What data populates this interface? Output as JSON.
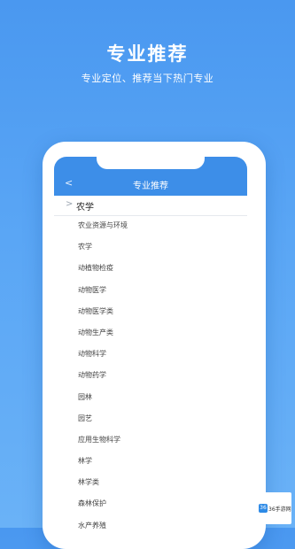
{
  "hero": {
    "title": "专业推荐",
    "subtitle": "专业定位、推荐当下热门专业"
  },
  "nav": {
    "back_icon": "chevron-left-icon",
    "back_glyph": "<",
    "title": "专业推荐"
  },
  "group": {
    "toggle_icon": "chevron-right-icon",
    "toggle_glyph": ">",
    "label": "农学"
  },
  "majors": [
    "农业资源与环境",
    "农学",
    "动植物检疫",
    "动物医学",
    "动物医学类",
    "动物生产类",
    "动物科学",
    "动物药学",
    "园林",
    "园艺",
    "应用生物科学",
    "林学",
    "林学类",
    "森林保护",
    "水产养殖"
  ],
  "badge": {
    "logo_text": "36",
    "text": "36手游网"
  },
  "colors": {
    "background": "#4a98f0",
    "navbar": "#3d8ee8",
    "text": "#444444"
  }
}
